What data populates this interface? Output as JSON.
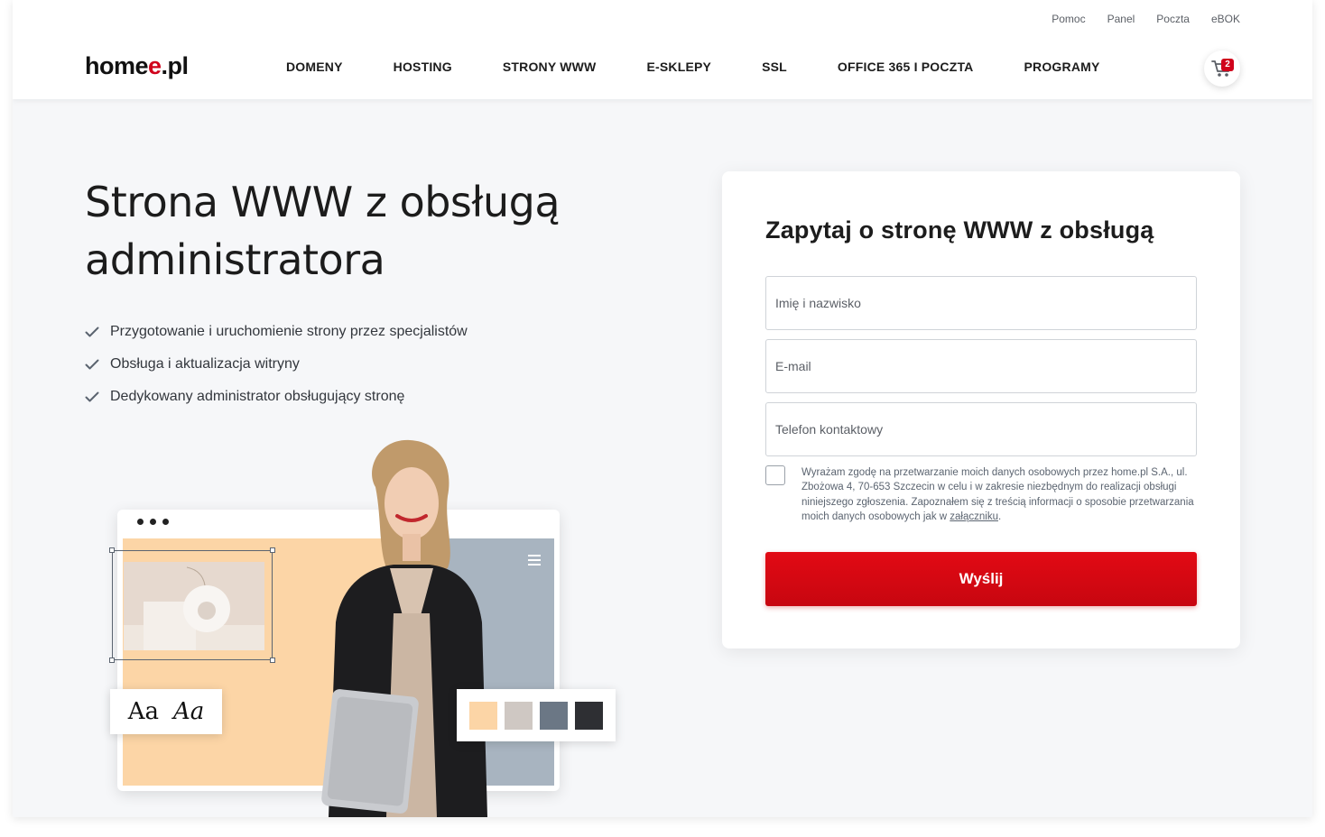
{
  "header": {
    "utility_links": [
      "Pomoc",
      "Panel",
      "Poczta",
      "eBOK"
    ],
    "logo": {
      "text_main": "home",
      "text_accent": "e",
      "text_tld": ".pl"
    },
    "nav": [
      "DOMENY",
      "HOSTING",
      "STRONY WWW",
      "E-SKLEPY",
      "SSL",
      "OFFICE 365 I POCZTA",
      "PROGRAMY"
    ],
    "cart": {
      "count": "2",
      "icon": "cart-icon"
    }
  },
  "hero": {
    "title": "Strona WWW z obsługą administratora",
    "features": [
      "Przygotowanie i uruchomienie strony przez specjalistów",
      "Obsługa i aktualizacja witryny",
      "Dedykowany administrator obsługujący stronę"
    ],
    "font_sample": {
      "regular": "Aa",
      "italic": "Aa"
    },
    "palette": [
      "#fcd5a6",
      "#cfc8c3",
      "#6b7785",
      "#2e2f33"
    ]
  },
  "form": {
    "title": "Zapytaj o stronę WWW z obsługą",
    "fields": {
      "name_placeholder": "Imię i nazwisko",
      "email_placeholder": "E-mail",
      "phone_placeholder": "Telefon kontaktowy"
    },
    "consent_text": "Wyrażam zgodę na przetwarzanie moich danych osobowych przez home.pl S.A., ul. Zbożowa 4, 70-653 Szczecin w celu i w zakresie niezbędnym do realizacji obsługi niniejszego zgłoszenia. Zapoznałem się z treścią informacji o sposobie przetwarzania moich danych osobowych jak w ",
    "consent_link": "załączniku",
    "consent_end": ".",
    "submit_label": "Wyślij"
  },
  "colors": {
    "brand_red": "#d0021b",
    "background": "#f6f7f9"
  }
}
